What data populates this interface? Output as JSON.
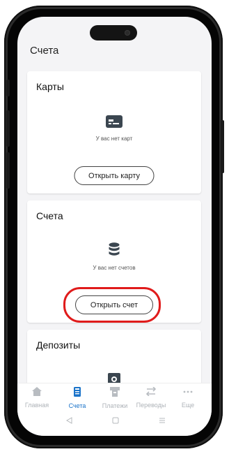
{
  "page": {
    "title": "Счета"
  },
  "cards": [
    {
      "title": "Карты",
      "icon": "card-icon",
      "empty_text": "У вас нет карт",
      "button_label": "Открыть карту"
    },
    {
      "title": "Счета",
      "icon": "database-icon",
      "empty_text": "У вас нет счетов",
      "button_label": "Открыть счет"
    },
    {
      "title": "Депозиты",
      "icon": "safe-icon"
    }
  ],
  "tabs": [
    {
      "label": "Главная",
      "icon": "home-icon",
      "active": false
    },
    {
      "label": "Счета",
      "icon": "phone-accounts-icon",
      "active": true
    },
    {
      "label": "Платежи",
      "icon": "payment-terminal-icon",
      "active": false
    },
    {
      "label": "Переводы",
      "icon": "transfer-arrows-icon",
      "active": false
    },
    {
      "label": "Еще",
      "icon": "more-dots-icon",
      "active": false
    }
  ],
  "system_nav": [
    "back-icon",
    "home-square-icon",
    "menu-lines-icon"
  ],
  "colors": {
    "accent": "#1a73c9",
    "highlight": "#e01b1b",
    "inactive": "#aeb3b8"
  }
}
